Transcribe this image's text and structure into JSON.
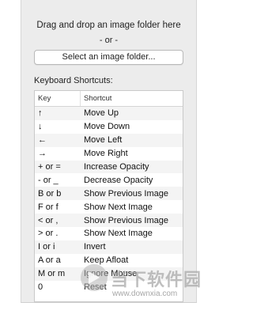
{
  "drop_area": {
    "title": "Drag and drop an image folder here",
    "or_text": "- or -",
    "select_button": "Select an image folder..."
  },
  "shortcuts": {
    "title": "Keyboard Shortcuts:",
    "headers": {
      "key": "Key",
      "shortcut": "Shortcut"
    },
    "rows": [
      {
        "key": "↑",
        "shortcut": "Move Up"
      },
      {
        "key": "↓",
        "shortcut": "Move Down"
      },
      {
        "key": "←",
        "shortcut": "Move Left"
      },
      {
        "key": "→",
        "shortcut": "Move Right"
      },
      {
        "key": "+ or =",
        "shortcut": "Increase Opacity"
      },
      {
        "key": "- or _",
        "shortcut": "Decrease Opacity"
      },
      {
        "key": "B or b",
        "shortcut": "Show Previous Image"
      },
      {
        "key": "F or f",
        "shortcut": "Show Next Image"
      },
      {
        "key": "< or ,",
        "shortcut": "Show Previous Image"
      },
      {
        "key": "> or .",
        "shortcut": "Show Next Image"
      },
      {
        "key": "I or i",
        "shortcut": "Invert"
      },
      {
        "key": "A or a",
        "shortcut": "Keep Afloat"
      },
      {
        "key": "M or m",
        "shortcut": "Ignore Mouse"
      },
      {
        "key": "0",
        "shortcut": "Reset"
      }
    ]
  },
  "watermark": {
    "name": "当下软件园",
    "url": "www.downxia.com"
  },
  "colors": {
    "panel_bg": "#ececec",
    "row_alt": "#f4f4f4",
    "border": "#c9c9c9"
  }
}
